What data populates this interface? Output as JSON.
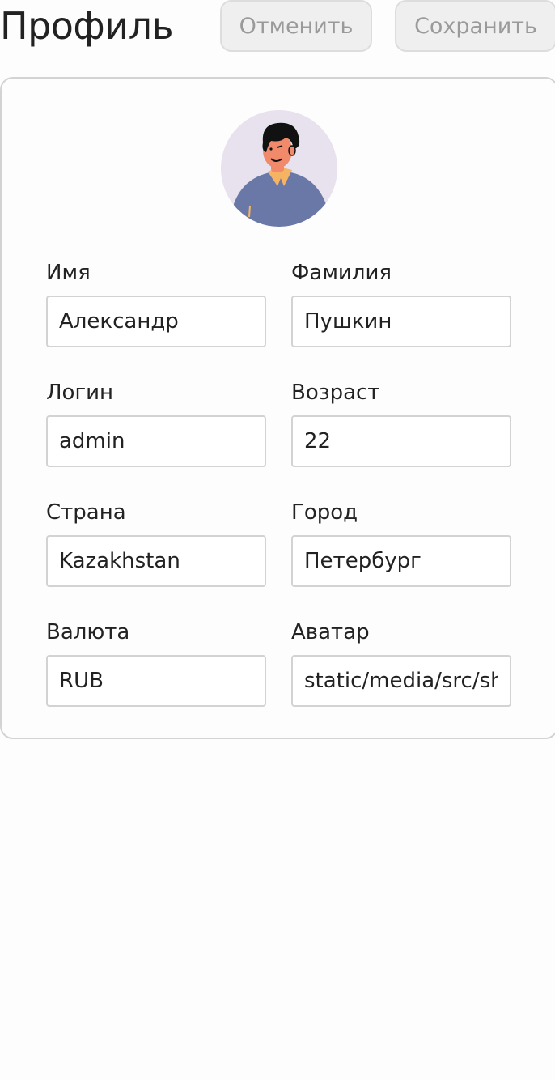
{
  "header": {
    "title": "Профиль",
    "cancel_label": "Отменить",
    "save_label": "Сохранить"
  },
  "profile": {
    "avatar_icon": "user-avatar-illustration",
    "fields": {
      "first_name": {
        "label": "Имя",
        "value": "Александр"
      },
      "last_name": {
        "label": "Фамилия",
        "value": "Пушкин"
      },
      "login": {
        "label": "Логин",
        "value": "admin"
      },
      "age": {
        "label": "Возраст",
        "value": "22"
      },
      "country": {
        "label": "Страна",
        "value": "Kazakhstan"
      },
      "city": {
        "label": "Город",
        "value": "Петербург"
      },
      "currency": {
        "label": "Валюта",
        "value": "RUB"
      },
      "avatar": {
        "label": "Аватар",
        "value": "static/media/src/shared/assets/tests/storybook.jpg"
      }
    }
  },
  "colors": {
    "avatar_bg": "#e8e2ef",
    "shirt": "#6a78a8",
    "skin": "#f08a6a",
    "hair": "#111111",
    "collar": "#f6b463"
  }
}
